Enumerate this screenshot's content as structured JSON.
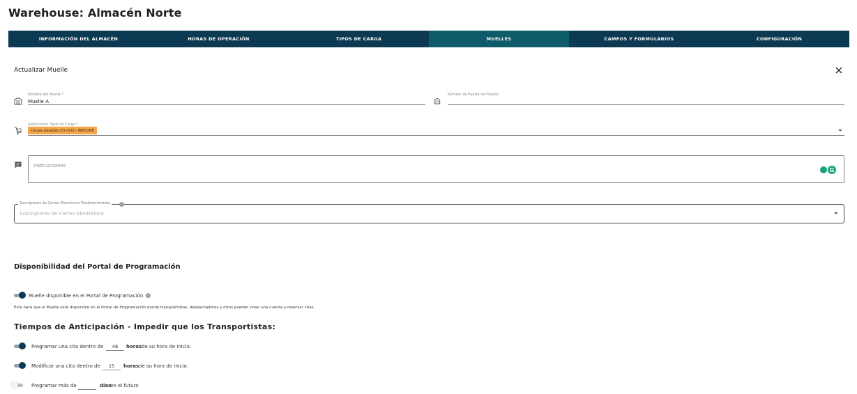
{
  "header": {
    "title": "Warehouse: Almacén Norte"
  },
  "tabs": [
    {
      "label": "INFORMACIÓN DEL ALMACÉN"
    },
    {
      "label": "HORAS DE OPERACIÓN"
    },
    {
      "label": "TIPOS DE CARGA"
    },
    {
      "label": "MUELLES"
    },
    {
      "label": "CAMPOS Y FORMULARIOS"
    },
    {
      "label": "CONFIGURACIÓN"
    }
  ],
  "active_tab": "MUELLES",
  "form": {
    "title": "Actualizar Muelle",
    "dock_name": {
      "label": "Nombre del Muelle *",
      "value": "Muelle A"
    },
    "door_number": {
      "label": "Número de Puerta del Muelle",
      "value": ""
    },
    "load_types": {
      "label": "Seleccionar Tipos de Carga *",
      "chip": "Cargas pesadas (15 min) - INBOUND"
    },
    "instructions": {
      "placeholder": "Instrucciones"
    },
    "subscribers": {
      "label": "Suscriptores de Correo Electrónico Predeterminados",
      "placeholder": "Suscriptores de Correo Electrónico"
    }
  },
  "portal": {
    "heading": "Disponibilidad del Portal de Programación",
    "toggle_label": "Muelle disponible en el Portal de Programación",
    "toggle_on": true,
    "description": "Esto hará que el Muelle esté disponible en el Portal de Programación donde transportistas, despachadores y otros pueden crear una cuenta y reservar citas."
  },
  "lead_times": {
    "heading": "Tiempos de Anticipación - Impedir que los Transportistas:",
    "rows": [
      {
        "prefix": "Programar una cita dentro de",
        "value": "48",
        "unit": "horas",
        "suffix": "de su hora de inicio.",
        "on": true
      },
      {
        "prefix": "Modificar una cita dentro de",
        "value": "15",
        "unit": "horas",
        "suffix": "de su hora de inicio.",
        "on": true
      },
      {
        "prefix": "Programar más de",
        "value": "",
        "unit": "días",
        "suffix": "en el futuro",
        "on": false
      }
    ]
  },
  "colors": {
    "tabbar": "#0c3a52",
    "active_tab": "#0e5c6a",
    "chip": "#f5a54a",
    "toggle_on": "#0c3a52",
    "grammar": "#15a37a"
  }
}
